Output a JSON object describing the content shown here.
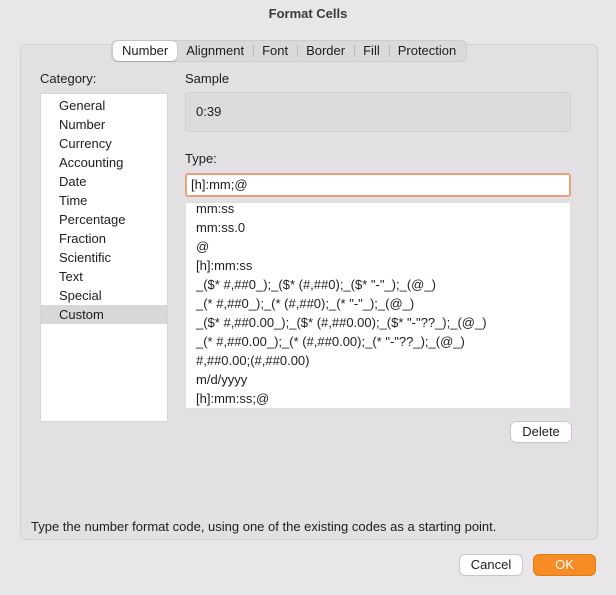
{
  "window": {
    "title": "Format Cells"
  },
  "tabs": [
    {
      "label": "Number"
    },
    {
      "label": "Alignment"
    },
    {
      "label": "Font"
    },
    {
      "label": "Border"
    },
    {
      "label": "Fill"
    },
    {
      "label": "Protection"
    }
  ],
  "category": {
    "label": "Category:",
    "items": [
      "General",
      "Number",
      "Currency",
      "Accounting",
      "Date",
      "Time",
      "Percentage",
      "Fraction",
      "Scientific",
      "Text",
      "Special",
      "Custom"
    ],
    "selected": "Custom"
  },
  "sample": {
    "label": "Sample",
    "value": "0:39"
  },
  "type": {
    "label": "Type:",
    "value": "[h]:mm;@",
    "formats": [
      "mm:ss",
      "mm:ss.0",
      "@",
      "[h]:mm:ss",
      "_($* #,##0_);_($* (#,##0);_($* \"-\"_);_(@_)",
      "_(* #,##0_);_(* (#,##0);_(* \"-\"_);_(@_)",
      "_($* #,##0.00_);_($* (#,##0.00);_($* \"-\"??_);_(@_)",
      "_(* #,##0.00_);_(* (#,##0.00);_(* \"-\"??_);_(@_)",
      "#,##0.00;(#,##0.00)",
      "m/d/yyyy",
      "[h]:mm:ss;@"
    ]
  },
  "buttons": {
    "delete": "Delete",
    "cancel": "Cancel",
    "ok": "OK"
  },
  "hint": "Type the number format code, using one of the existing codes as a starting point.",
  "colors": {
    "accent": "#f78b24",
    "focus_ring": "#e8a17c"
  }
}
